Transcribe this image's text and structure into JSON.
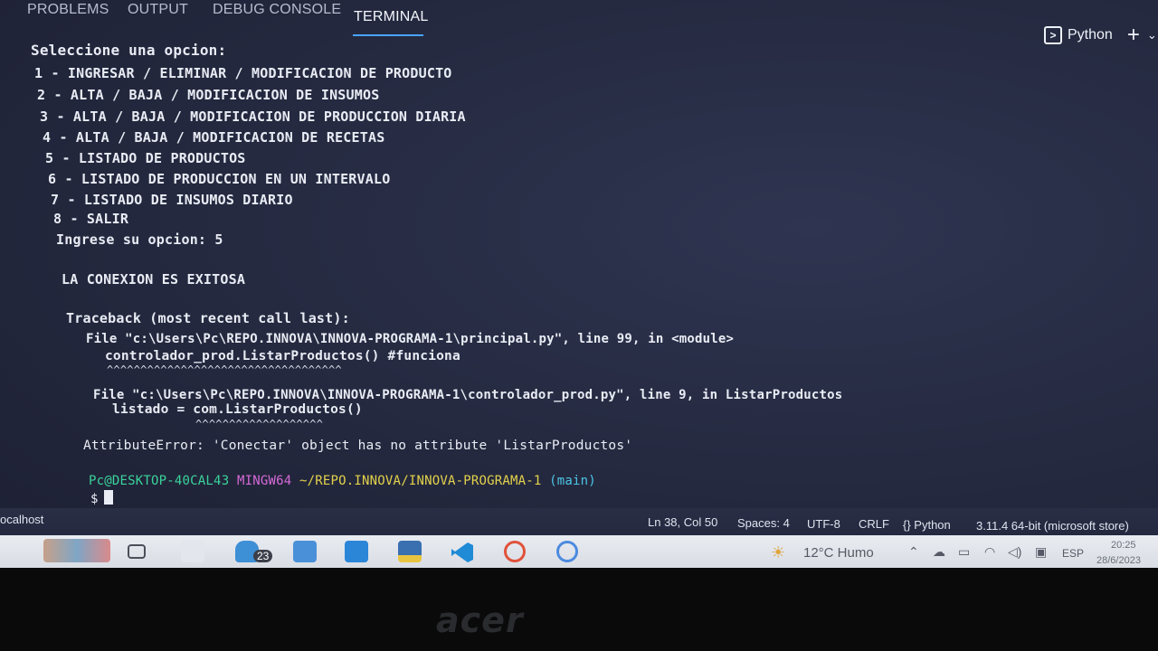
{
  "panel": {
    "tabs": [
      "PROBLEMS",
      "OUTPUT",
      "DEBUG CONSOLE",
      "TERMINAL"
    ],
    "active_tab": "TERMINAL",
    "profile_label": "Python",
    "plus_glyph": "+",
    "chevron_glyph": "⌄"
  },
  "terminal": {
    "menu_title": "Seleccione una opcion:",
    "menu": [
      "1 - INGRESAR / ELIMINAR / MODIFICACION DE PRODUCTO",
      "2 - ALTA / BAJA / MODIFICACION DE INSUMOS",
      "3 - ALTA / BAJA / MODIFICACION DE PRODUCCION DIARIA",
      "4 - ALTA / BAJA / MODIFICACION DE RECETAS",
      "5 - LISTADO DE PRODUCTOS",
      "6 - LISTADO DE PRODUCCION EN UN INTERVALO",
      "7 - LISTADO DE INSUMOS DIARIO",
      "8 - SALIR"
    ],
    "prompt_input": "Ingrese su opcion: 5",
    "connection": "LA CONEXION ES EXITOSA",
    "traceback_header": "Traceback (most recent call last):",
    "tb_file1": "File \"c:\\Users\\Pc\\REPO.INNOVA\\INNOVA-PROGRAMA-1\\principal.py\", line 99, in <module>",
    "tb_code1": "controlador_prod.ListarProductos() #funciona",
    "tb_caret1": "^^^^^^^^^^^^^^^^^^^^^^^^^^^^^^^^^^^",
    "tb_file2": "File \"c:\\Users\\Pc\\REPO.INNOVA\\INNOVA-PROGRAMA-1\\controlador_prod.py\", line 9, in ListarProductos",
    "tb_code2": "listado = com.ListarProductos()",
    "tb_caret2": "^^^^^^^^^^^^^^^^^^^",
    "error": "AttributeError: 'Conectar' object has no attribute 'ListarProductos'",
    "prompt_user": "Pc@DESKTOP-40CAL43",
    "prompt_env": "MINGW64",
    "prompt_path": "~/REPO.INNOVA/INNOVA-PROGRAMA-1",
    "prompt_branch": "(main)",
    "prompt_symbol": "$"
  },
  "statusbar": {
    "remote": "ocalhost",
    "position": "Ln 38, Col 50",
    "spaces": "Spaces: 4",
    "encoding": "UTF-8",
    "eol": "CRLF",
    "language": "{} Python",
    "interpreter": "3.11.4 64-bit (microsoft store)"
  },
  "taskbar": {
    "mail_badge": "23",
    "weather": "12°C  Humo",
    "lang": "ESP",
    "time": "20:25",
    "date": "28/6/2023"
  },
  "bezel": {
    "brand": "acer"
  },
  "colors": {
    "accent": "#4aa3ff",
    "prompt_user": "#3ad39b",
    "prompt_env": "#d66ad8",
    "prompt_path": "#e3d24b",
    "prompt_branch": "#4cc5e6"
  }
}
